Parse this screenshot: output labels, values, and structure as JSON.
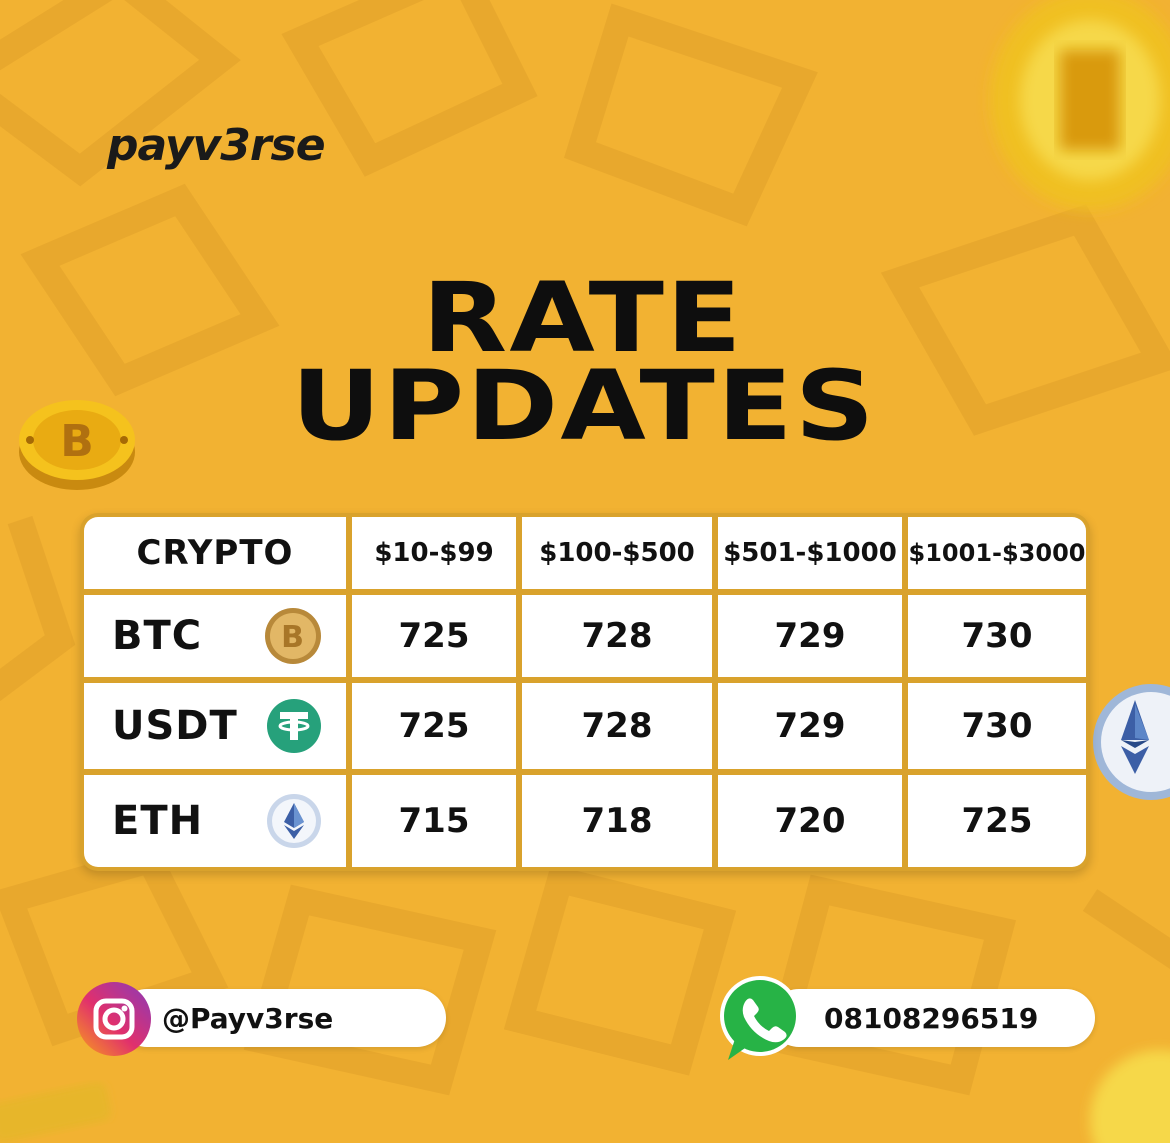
{
  "brand": {
    "logo": "payv3rse"
  },
  "title": {
    "line1": "RATE",
    "line2": "UPDATES"
  },
  "table": {
    "headers": [
      "CRYPTO",
      "$10-$99",
      "$100-$500",
      "$501-$1000",
      "$1001-$3000"
    ],
    "rows": [
      {
        "coin": "BTC",
        "icon": "bitcoin-icon",
        "values": [
          "725",
          "728",
          "729",
          "730"
        ]
      },
      {
        "coin": "USDT",
        "icon": "tether-icon",
        "values": [
          "725",
          "728",
          "729",
          "730"
        ]
      },
      {
        "coin": "ETH",
        "icon": "ethereum-icon",
        "values": [
          "715",
          "718",
          "720",
          "725"
        ]
      }
    ]
  },
  "contacts": {
    "instagram": {
      "handle": "@Payv3rse",
      "icon": "instagram-icon"
    },
    "whatsapp": {
      "number": "08108296519",
      "icon": "whatsapp-icon"
    }
  },
  "colors": {
    "background": "#f2b232",
    "table_border": "#d9a22c",
    "text": "#111111"
  }
}
